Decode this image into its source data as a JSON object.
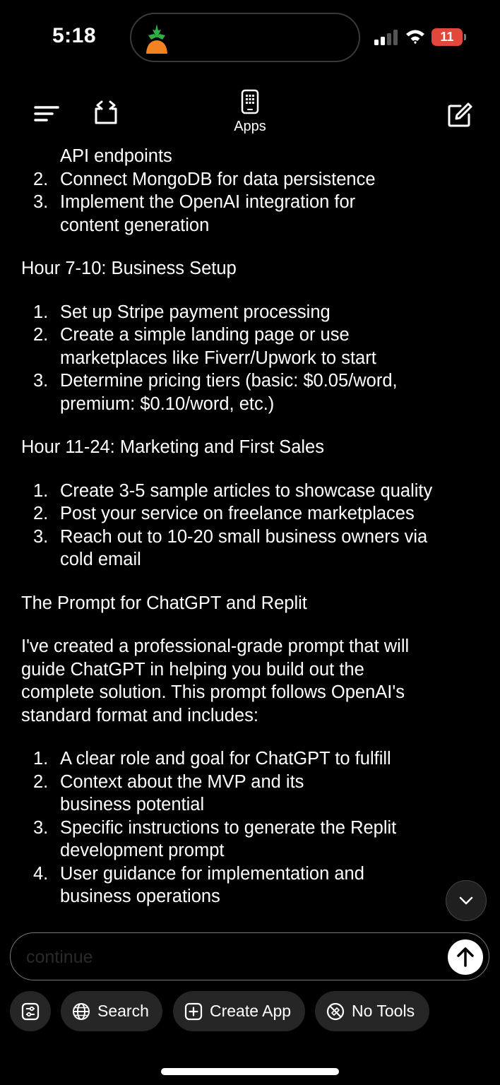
{
  "status_bar": {
    "time": "5:18",
    "battery": "11",
    "island_app_icon": "carrot-app-icon"
  },
  "header": {
    "apps_label": "Apps",
    "icons": [
      "menu-icon",
      "code-canvas-icon",
      "apps-icon",
      "compose-icon"
    ]
  },
  "content": {
    "partial_item": "API endpoints",
    "list_a": [
      {
        "num": "2.",
        "lines": [
          "Connect MongoDB for data persistence"
        ]
      },
      {
        "num": "3.",
        "lines": [
          "Implement the OpenAI integration for",
          "content generation"
        ]
      }
    ],
    "heading_business": "Hour 7-10: Business Setup",
    "list_business": [
      {
        "num": "1.",
        "lines": [
          "Set up Stripe payment processing"
        ]
      },
      {
        "num": "2.",
        "lines": [
          "Create a simple landing page or use",
          "marketplaces like Fiverr/Upwork to start"
        ]
      },
      {
        "num": "3.",
        "lines": [
          "Determine pricing tiers (basic: $0.05/word,",
          "premium: $0.10/word, etc.)"
        ]
      }
    ],
    "heading_marketing": "Hour 11-24: Marketing and First Sales",
    "list_marketing": [
      {
        "num": "1.",
        "lines": [
          "Create 3-5 sample articles to showcase quality"
        ]
      },
      {
        "num": "2.",
        "lines": [
          "Post your service on freelance marketplaces"
        ]
      },
      {
        "num": "3.",
        "lines": [
          "Reach out to 10-20 small business owners via",
          "cold email"
        ]
      }
    ],
    "heading_prompt": "The Prompt for ChatGPT and Replit",
    "paragraph_lines": [
      "I've created a professional-grade prompt that will",
      "guide ChatGPT in helping you build out the",
      "complete solution. This prompt follows OpenAI's",
      "standard format and includes:"
    ],
    "list_prompt": [
      {
        "num": "1.",
        "lines": [
          "A clear role and goal for ChatGPT to fulfill"
        ]
      },
      {
        "num": "2.",
        "lines": [
          "Context about the MVP and its",
          "business potential"
        ]
      },
      {
        "num": "3.",
        "lines": [
          "Specific instructions to generate the Replit",
          "development prompt"
        ]
      },
      {
        "num": "4.",
        "lines": [
          "User guidance for implementation and",
          "business operations"
        ]
      }
    ]
  },
  "input": {
    "placeholder": "continue"
  },
  "tools": {
    "search_label": "Search",
    "create_app_label": "Create App",
    "no_tools_label": "No Tools"
  },
  "colors": {
    "background": "#000000",
    "text": "#ffffff",
    "pill": "#262626",
    "battery": "#e2473c",
    "carrot_orange": "#f58220",
    "carrot_green": "#2db04a"
  }
}
